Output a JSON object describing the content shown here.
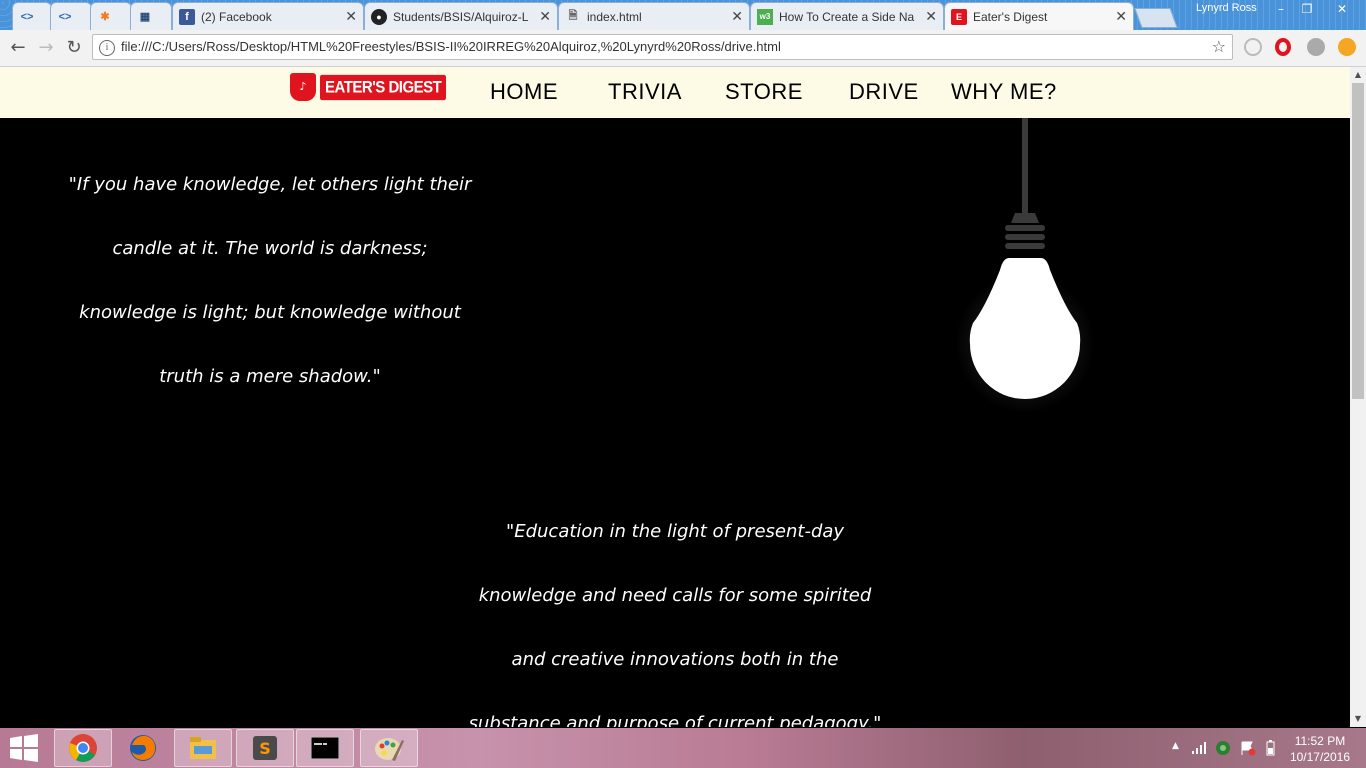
{
  "browser": {
    "tabs": [
      {
        "title": "",
        "icon": "code-icon"
      },
      {
        "title": "",
        "icon": "code-icon"
      },
      {
        "title": "",
        "icon": "avast-icon"
      },
      {
        "title": "",
        "icon": "grid-icon"
      },
      {
        "title": "(2) Facebook",
        "icon": "facebook-icon"
      },
      {
        "title": "Students/BSIS/Alquiroz-L",
        "icon": "github-icon"
      },
      {
        "title": "index.html",
        "icon": "file-icon"
      },
      {
        "title": "How To Create a Side Na",
        "icon": "w3schools-icon"
      },
      {
        "title": "Eater's Digest",
        "icon": "eaters-digest-icon"
      }
    ],
    "profile_name": "Lynyrd Ross",
    "url": "file:///C:/Users/Ross/Desktop/HTML%20Freestyles/BSIS-II%20IRREG%20Alquiroz,%20Lynyrd%20Ross/drive.html"
  },
  "site": {
    "logo_text": "EATER'S DIGEST",
    "nav": [
      "HOME",
      "TRIVIA",
      "STORE",
      "DRIVE",
      "WHY ME?"
    ]
  },
  "quotes": {
    "first": [
      "\"If you have knowledge, let others light their",
      "candle at it. The world is darkness;",
      "knowledge is light; but knowledge without",
      "truth is a mere shadow.\""
    ],
    "second": [
      "\"Education in the light of present-day",
      "knowledge and need calls for some spirited",
      "and creative innovations both in the",
      "substance and purpose of current pedagogy.\""
    ]
  },
  "taskbar": {
    "apps": [
      "chrome-icon",
      "firefox-icon",
      "file-explorer-icon",
      "sublime-text-icon",
      "command-prompt-icon",
      "paint-icon"
    ],
    "time": "11:52 PM",
    "date": "10/17/2016"
  },
  "colors": {
    "logo_red": "#e0141e",
    "header_bg": "#fdfbe6",
    "page_bg": "#000000"
  }
}
